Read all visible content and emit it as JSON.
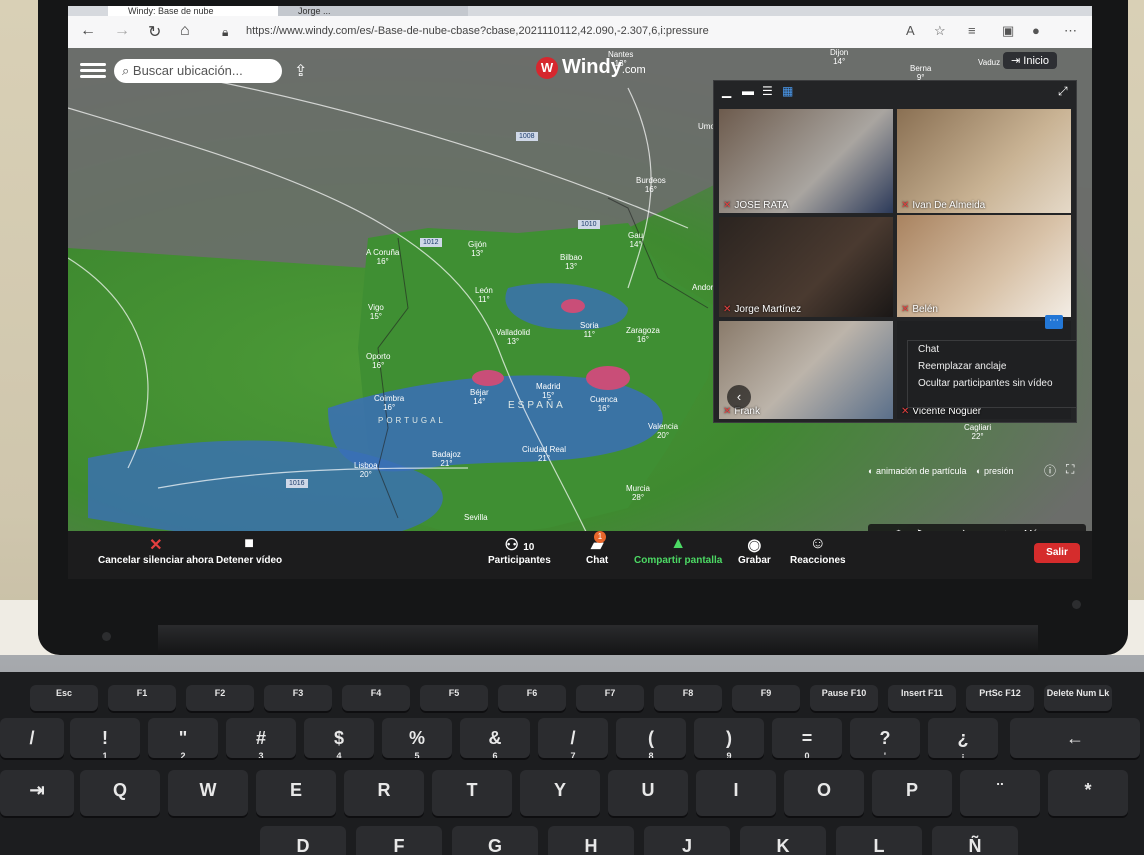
{
  "browser": {
    "tab_active": "Windy: Base de nube",
    "tab_other": "Jorge ...",
    "url": "https://www.windy.com/es/-Base-de-nube-cbase?cbase,2021110112,42.090,-2.307,6,i:pressure"
  },
  "windy": {
    "search_placeholder": "Buscar ubicación...",
    "logo_text": "Windy",
    "logo_suffix": ".com",
    "home_button": "Inicio",
    "particle_toggle": "animación de partícula",
    "pressure_toggle": "presión",
    "more_layers": "Más capas...",
    "countries": [
      "ESPAÑA",
      "PORTUGAL"
    ],
    "isobars": [
      "1008",
      "1010",
      "1012",
      "1016"
    ],
    "cities": [
      {
        "name": "A Coruña",
        "temp": "16°"
      },
      {
        "name": "Gijón",
        "temp": "13°"
      },
      {
        "name": "Bilbao",
        "temp": "13°"
      },
      {
        "name": "León",
        "temp": "11°"
      },
      {
        "name": "Vigo",
        "temp": "15°"
      },
      {
        "name": "Oporto",
        "temp": "16°"
      },
      {
        "name": "Valladolid",
        "temp": "13°"
      },
      {
        "name": "Soria",
        "temp": "11°"
      },
      {
        "name": "Zaragoza",
        "temp": "16°"
      },
      {
        "name": "Coimbra",
        "temp": "16°"
      },
      {
        "name": "Béjar",
        "temp": "14°"
      },
      {
        "name": "Madrid",
        "temp": "15°"
      },
      {
        "name": "Cuenca",
        "temp": "16°"
      },
      {
        "name": "Valencia",
        "temp": "20°"
      },
      {
        "name": "Lisboa",
        "temp": "20°"
      },
      {
        "name": "Badajoz",
        "temp": "21°"
      },
      {
        "name": "Ciudad Real",
        "temp": "21°"
      },
      {
        "name": "Murcia",
        "temp": "28°"
      },
      {
        "name": "Sevilla",
        "temp": ""
      },
      {
        "name": "Burdeos",
        "temp": "16°"
      },
      {
        "name": "Gau",
        "temp": "14°"
      },
      {
        "name": "Andor",
        "temp": ""
      },
      {
        "name": "Dijon",
        "temp": "14°"
      },
      {
        "name": "Berna",
        "temp": "9°"
      },
      {
        "name": "Vaduz",
        "temp": ""
      },
      {
        "name": "Nantes",
        "temp": "13°"
      },
      {
        "name": "Cagliari",
        "temp": "22°"
      },
      {
        "name": "Umo",
        "temp": ""
      }
    ]
  },
  "zoom": {
    "participants": [
      {
        "name": "JOSE RATA"
      },
      {
        "name": "Ivan De Almeida"
      },
      {
        "name": "Jorge Martínez"
      },
      {
        "name": "Belén"
      },
      {
        "name": "Frank"
      },
      {
        "name": "Vicente Noguer"
      }
    ],
    "context_menu": [
      "Chat",
      "Reemplazar anclaje",
      "Ocultar participantes sin vídeo"
    ],
    "toolbar": {
      "mute": "Cancelar silenciar ahora",
      "video": "Detener vídeo",
      "participants": "Participantes",
      "participants_count": "10",
      "chat": "Chat",
      "chat_badge": "1",
      "share": "Compartir pantalla",
      "record": "Grabar",
      "reactions": "Reacciones",
      "leave": "Salir"
    }
  },
  "keyboard": {
    "fn_row": [
      {
        "k": "Esc",
        "s": ""
      },
      {
        "k": "F1",
        "s": ""
      },
      {
        "k": "F2",
        "s": ""
      },
      {
        "k": "F3",
        "s": ""
      },
      {
        "k": "F4",
        "s": ""
      },
      {
        "k": "F5",
        "s": ""
      },
      {
        "k": "F6",
        "s": ""
      },
      {
        "k": "F7",
        "s": ""
      },
      {
        "k": "F8",
        "s": ""
      },
      {
        "k": "F9",
        "s": ""
      },
      {
        "k": "Pause F10",
        "s": ""
      },
      {
        "k": "Insert F11",
        "s": ""
      },
      {
        "k": "PrtSc F12",
        "s": ""
      },
      {
        "k": "Delete Num Lk",
        "s": ""
      }
    ],
    "num_row": [
      "!\n1",
      "\"\n2",
      "#\n3",
      "$\n4",
      "%\n5",
      "&\n6",
      "/\n7",
      "(\n8",
      ")\n9",
      "=\n0",
      "?\n'",
      "¿\n¡"
    ],
    "top_row": [
      "Q",
      "W",
      "E",
      "R",
      "T",
      "Y",
      "U",
      "I",
      "O",
      "P",
      "¨",
      "*"
    ],
    "home_row": [
      "D",
      "F",
      "G",
      "H",
      "J",
      "K",
      "L",
      "Ñ"
    ]
  }
}
